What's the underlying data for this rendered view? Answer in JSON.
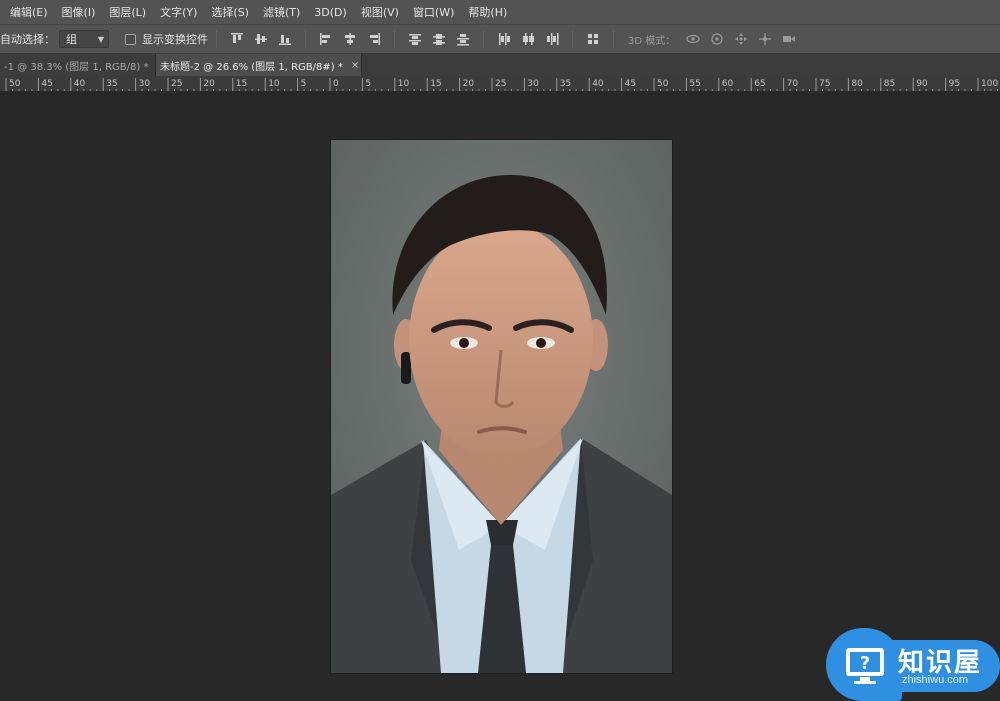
{
  "menu": [
    "编辑(E)",
    "图像(I)",
    "图层(L)",
    "文字(Y)",
    "选择(S)",
    "滤镜(T)",
    "3D(D)",
    "视图(V)",
    "窗口(W)",
    "帮助(H)"
  ],
  "options": {
    "auto_select_label": "自动选择：",
    "auto_select_value": "组",
    "show_transform_label": "显示变换控件",
    "mode_3d_label": "3D 模式："
  },
  "tabs": [
    {
      "label": "-1 @ 38.3% (图层 1, RGB/8) *",
      "close": "×"
    },
    {
      "label": "未标题-2 @ 26.6% (图层 1, RGB/8#) *",
      "close": "×"
    }
  ],
  "ruler_labels": [
    "50",
    "45",
    "40",
    "35",
    "30",
    "25",
    "20",
    "15",
    "10",
    "5",
    "0",
    "5",
    "10",
    "15",
    "20",
    "25",
    "30",
    "35",
    "40",
    "45",
    "50",
    "55",
    "60",
    "65",
    "70",
    "75",
    "80",
    "85",
    "90",
    "95",
    "100"
  ],
  "watermark": {
    "title": "知识屋",
    "subtitle": "zhishiwu.com"
  },
  "colors": {
    "menubar": "#535353",
    "canvas": "#282828",
    "accent": "#2f8fe0"
  }
}
